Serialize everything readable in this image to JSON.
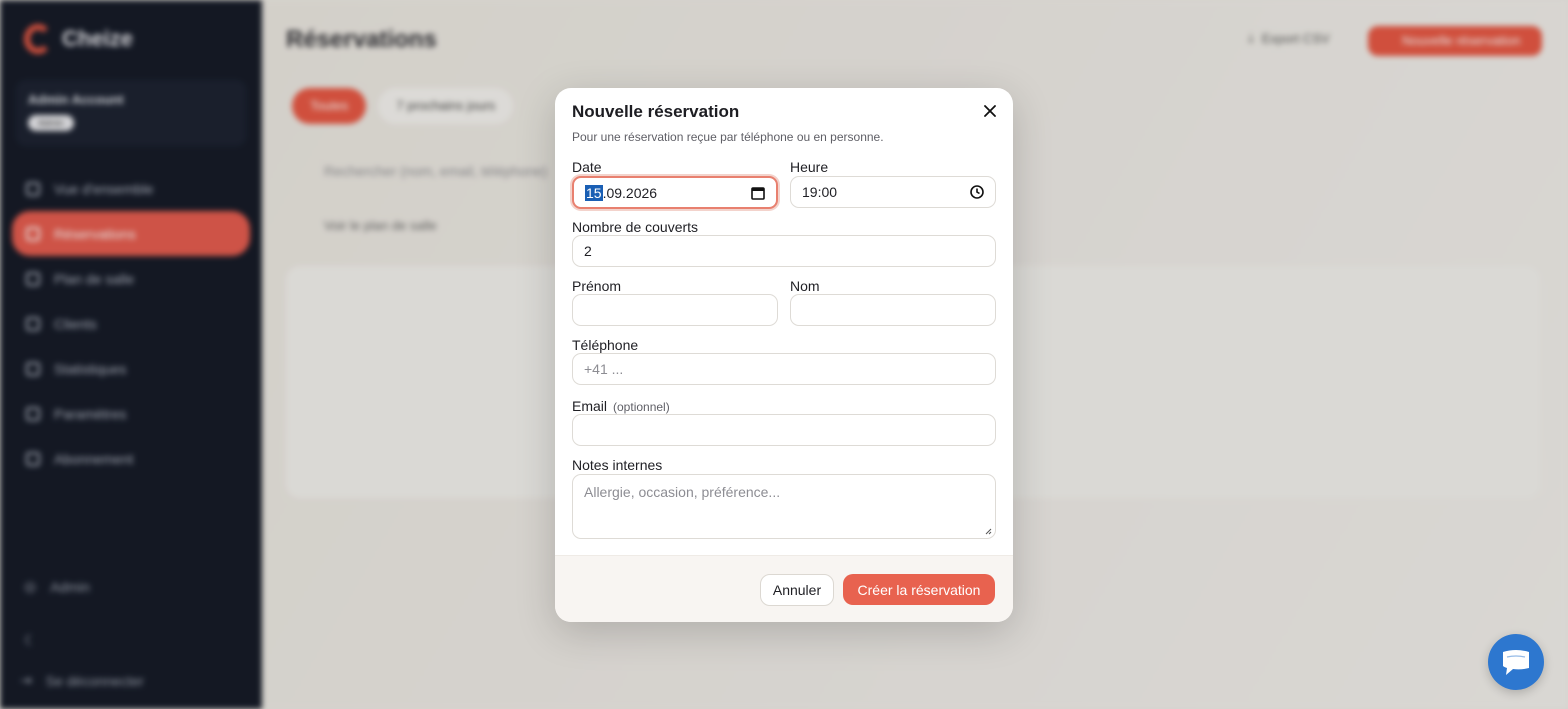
{
  "brand": {
    "name": "Cheize",
    "accent": "#e5533f"
  },
  "account": {
    "name": "Admin Account",
    "badge": "Admin"
  },
  "sidebar": {
    "items": [
      {
        "label": "Vue d'ensemble",
        "icon": "grid-icon"
      },
      {
        "label": "Réservations",
        "icon": "calendar-icon",
        "active": true
      },
      {
        "label": "Plan de salle",
        "icon": "map-icon"
      },
      {
        "label": "Clients",
        "icon": "users-icon"
      },
      {
        "label": "Statistiques",
        "icon": "chart-icon"
      },
      {
        "label": "Paramètres",
        "icon": "gear-icon"
      },
      {
        "label": "Abonnement",
        "icon": "card-icon"
      }
    ],
    "admin_label": "Admin",
    "logout_label": "Se déconnecter"
  },
  "page": {
    "title": "Réservations",
    "export_label": "Export CSV",
    "new_label": "Nouvelle réservation",
    "filters": [
      "Toutes",
      "7 prochains jours"
    ],
    "search_placeholder": "Rechercher (nom, email, téléphone)",
    "plan_link": "Voir le plan de salle"
  },
  "modal": {
    "title": "Nouvelle réservation",
    "subtitle": "Pour une réservation reçue par téléphone ou en personne.",
    "date": {
      "label": "Date",
      "day": "15",
      "rest": ".09.2026"
    },
    "time": {
      "label": "Heure",
      "value": "19:00"
    },
    "covers": {
      "label": "Nombre de couverts",
      "value": "2"
    },
    "first_name": {
      "label": "Prénom",
      "value": ""
    },
    "last_name": {
      "label": "Nom",
      "value": ""
    },
    "phone": {
      "label": "Téléphone",
      "placeholder": "+41 ..."
    },
    "email": {
      "label": "Email",
      "optional": "(optionnel)",
      "value": ""
    },
    "notes": {
      "label": "Notes internes",
      "placeholder": "Allergie, occasion, préférence..."
    },
    "cancel_label": "Annuler",
    "create_label": "Créer la réservation"
  }
}
